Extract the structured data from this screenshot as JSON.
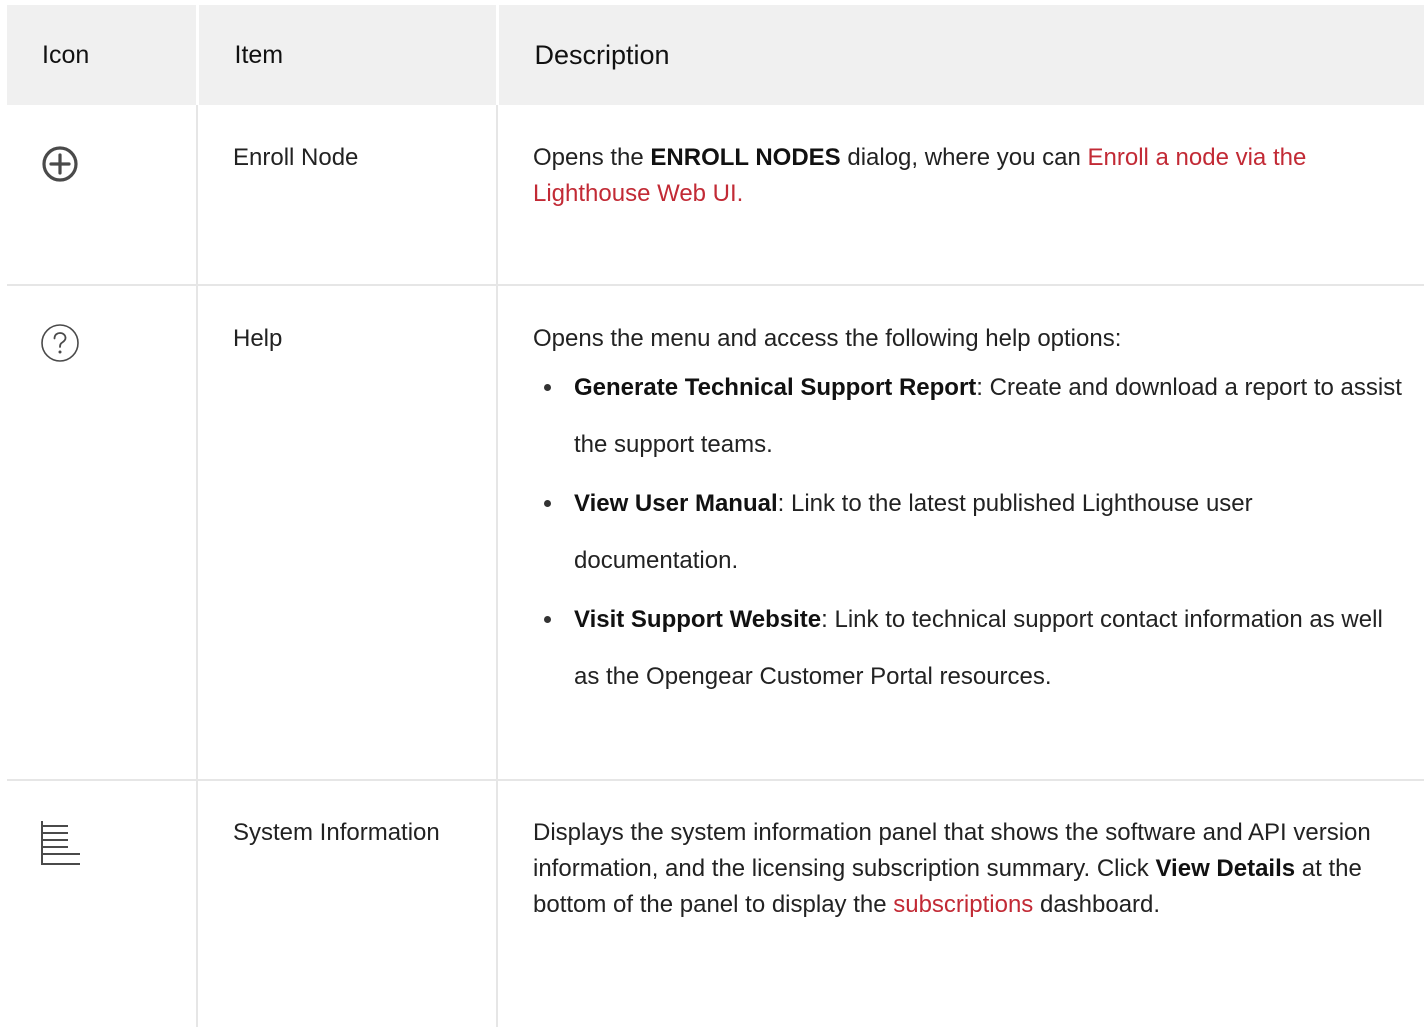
{
  "table": {
    "headers": {
      "icon": "Icon",
      "item": "Item",
      "description": "Description"
    },
    "rows": [
      {
        "icon": "add-circle-icon",
        "item": "Enroll Node",
        "desc_prefix": "Opens the ",
        "desc_bold": "ENROLL NODES",
        "desc_mid": " dialog, where you can ",
        "desc_link": "Enroll a node via the Lighthouse Web UI."
      },
      {
        "icon": "help-circle-icon",
        "item": "Help",
        "desc_intro": "Opens the menu and access the following help options:",
        "options": [
          {
            "name": "Generate Technical Support Report",
            "text": ": Create and download a report to assist the support teams."
          },
          {
            "name": "View User Manual",
            "text": ": Link to the latest published Lighthouse user documentation."
          },
          {
            "name": "Visit Support Website",
            "text": ": Link to technical support contact inform­ation as well as the Opengear Customer Portal resources."
          }
        ]
      },
      {
        "icon": "system-info-icon",
        "item": "System Information",
        "desc_prefix": "Displays the system information panel that shows the software and API version information, and the licensing subscription summary. Click ",
        "desc_bold": "View Details",
        "desc_mid": " at the bottom of the panel to display the ",
        "desc_link": "subscriptions",
        "desc_suffix": " dash­board."
      }
    ]
  },
  "colors": {
    "header_bg": "#f0f0f0",
    "link": "#c22a35",
    "border": "#e6e6e6"
  }
}
